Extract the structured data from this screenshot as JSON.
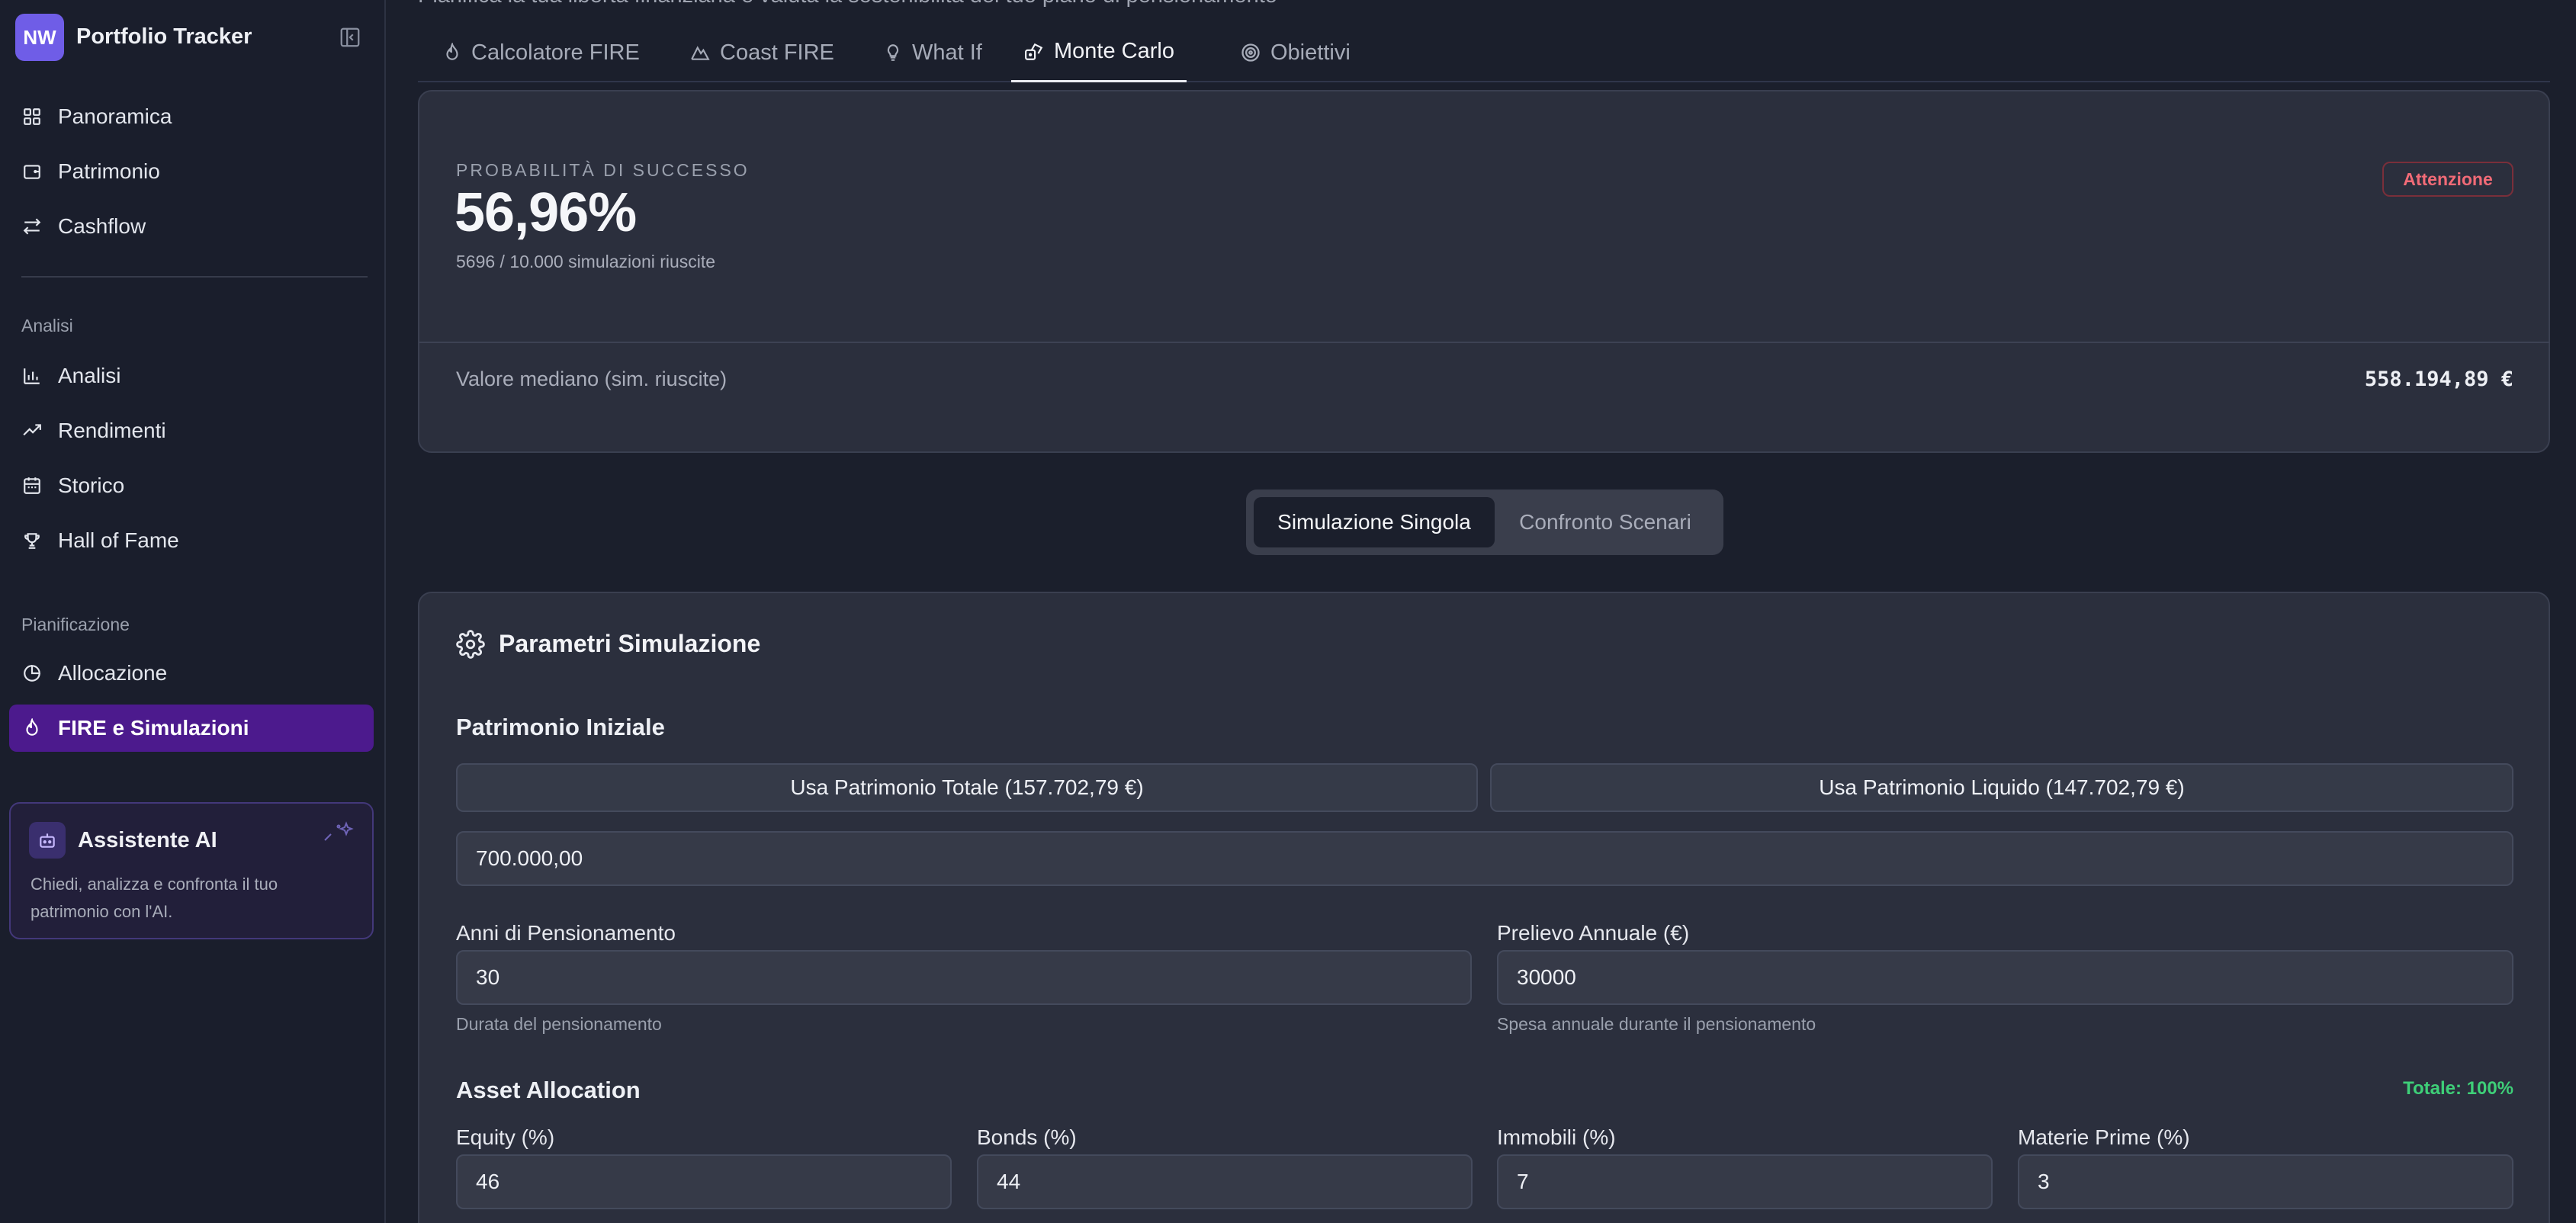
{
  "sidebar": {
    "logo_initials": "NW",
    "app_title": "Portfolio Tracker",
    "main_items": [
      {
        "label": "Panoramica",
        "icon": "grid-icon"
      },
      {
        "label": "Patrimonio",
        "icon": "wallet-icon"
      },
      {
        "label": "Cashflow",
        "icon": "arrows-swap-icon"
      }
    ],
    "section_analysis": "Analisi",
    "analysis_items": [
      {
        "label": "Analisi",
        "icon": "bar-chart-icon"
      },
      {
        "label": "Rendimenti",
        "icon": "trend-up-icon"
      },
      {
        "label": "Storico",
        "icon": "calendar-icon"
      },
      {
        "label": "Hall of Fame",
        "icon": "trophy-icon"
      }
    ],
    "section_planning": "Pianificazione",
    "planning_items": [
      {
        "label": "Allocazione",
        "icon": "pie-icon"
      },
      {
        "label": "FIRE e Simulazioni",
        "icon": "flame-icon",
        "active": true
      }
    ],
    "ai_card": {
      "title": "Assistente AI",
      "description": "Chiedi, analizza e confronta il tuo patrimonio con l'AI."
    }
  },
  "header": {
    "subtitle": "Pianifica la tua libertà finanziaria e valuta la sostenibilità del tuo piano di pensionamento"
  },
  "tabs": [
    {
      "label": "Calcolatore FIRE",
      "icon": "flame-icon"
    },
    {
      "label": "Coast FIRE",
      "icon": "mountain-icon"
    },
    {
      "label": "What If",
      "icon": "lightbulb-icon"
    },
    {
      "label": "Monte Carlo",
      "icon": "dice-icon",
      "active": true
    },
    {
      "label": "Obiettivi",
      "icon": "target-icon"
    }
  ],
  "results": {
    "prob_label": "PROBABILITÀ DI SUCCESSO",
    "prob_value": "56,96%",
    "prob_sub": "5696 / 10.000 simulazioni riuscite",
    "status_badge": "Attenzione",
    "median_label": "Valore mediano (sim. riuscite)",
    "median_value": "558.194,89 €"
  },
  "mode_toggle": {
    "single": "Simulazione Singola",
    "compare": "Confronto Scenari"
  },
  "params": {
    "title": "Parametri Simulazione",
    "initial_heading": "Patrimonio Iniziale",
    "use_total_btn": "Usa Patrimonio Totale (157.702,79 €)",
    "use_liquid_btn": "Usa Patrimonio Liquido (147.702,79 €)",
    "initial_value": "700.000,00",
    "years_label": "Anni di Pensionamento",
    "years_value": "30",
    "years_hint": "Durata del pensionamento",
    "withdraw_label": "Prelievo Annuale (€)",
    "withdraw_value": "30000",
    "withdraw_hint": "Spesa annuale durante il pensionamento",
    "allocation_heading": "Asset Allocation",
    "allocation_total": "Totale: 100%",
    "equity_label": "Equity (%)",
    "equity_value": "46",
    "bonds_label": "Bonds (%)",
    "bonds_value": "44",
    "realestate_label": "Immobili (%)",
    "realestate_value": "7",
    "commodities_label": "Materie Prime (%)",
    "commodities_value": "3"
  },
  "colors": {
    "accent": "#6f5de7",
    "active_nav": "#4c1a8d",
    "warning": "#f26b77",
    "success": "#3ecf78"
  }
}
